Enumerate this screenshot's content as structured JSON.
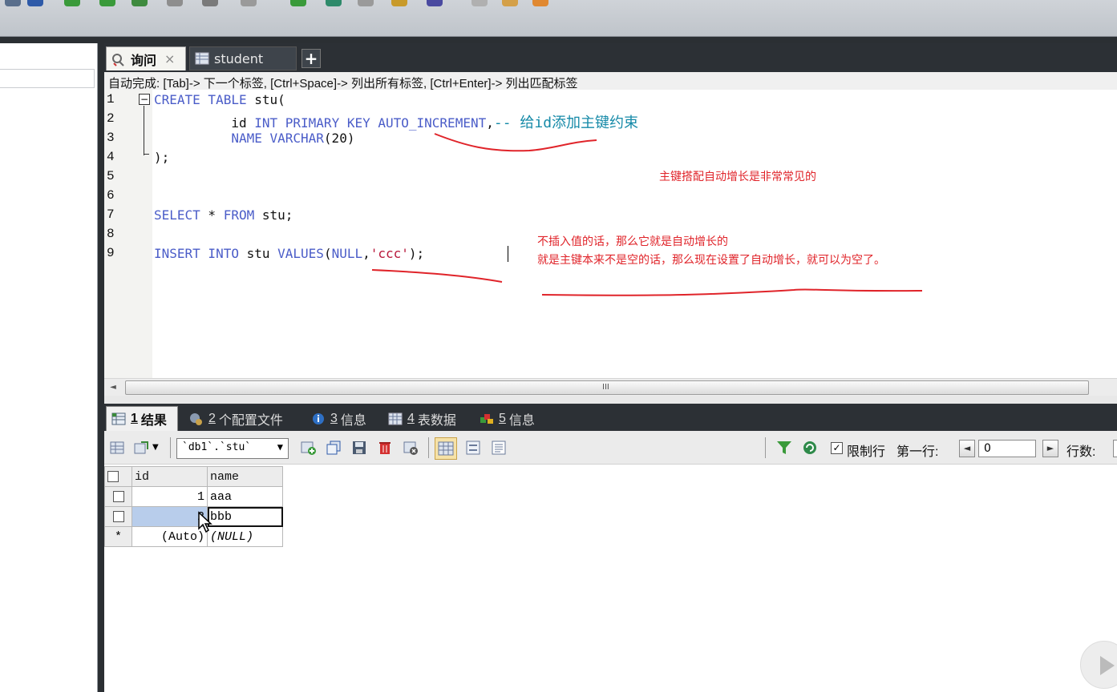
{
  "tabs": {
    "query_label": "询问",
    "student_label": "student",
    "close_glyph": "×",
    "add_glyph": "+"
  },
  "hint": "自动完成: [Tab]-> 下一个标签, [Ctrl+Space]-> 列出所有标签, [Ctrl+Enter]-> 列出匹配标签",
  "editor": {
    "line_numbers": [
      "1",
      "2",
      "3",
      "4",
      "5",
      "6",
      "7",
      "8",
      "9"
    ],
    "fold_glyph": "⊟",
    "line1": {
      "kw": "CREATE TABLE",
      "rest": " stu("
    },
    "line2": {
      "indent": "          ",
      "col": "id ",
      "kw1": "INT PRIMARY KEY AUTO_INCREMENT",
      "sep": ",",
      "comment": "-- 给id添加主键约束"
    },
    "line3": {
      "indent": "          ",
      "kw": "NAME VARCHAR",
      "rest": "(20)"
    },
    "line4": {
      "text": ");"
    },
    "line7": {
      "kw1": "SELECT",
      "mid": " * ",
      "kw2": "FROM",
      "rest": " stu;"
    },
    "line9": {
      "kw1": "INSERT INTO",
      "mid": " stu ",
      "kw2": "VALUES",
      "p1": "(",
      "kw3": "NULL",
      "comma": ",",
      "str": "'ccc'",
      "end": ");"
    }
  },
  "annotations": {
    "note1": "主键搭配自动增长是非常常见的",
    "note2": "不插入值的话，那么它就是自动增长的",
    "note3": "就是主键本来不是空的话，那么现在设置了自动增长，就可以为空了。"
  },
  "scrollbar_grip": "III",
  "result_tabs": [
    {
      "num": "1",
      "label": "结果"
    },
    {
      "num": "2",
      "label": "个配置文件"
    },
    {
      "num": "3",
      "label": "信息"
    },
    {
      "num": "4",
      "label": "表数据"
    },
    {
      "num": "5",
      "label": "信息"
    }
  ],
  "result_toolbar": {
    "db_select": "`db1`.`stu`",
    "limit_checked": "✓",
    "limit_label": "限制行",
    "first_row_label": "第一行:",
    "first_row_value": "0",
    "rows_label": "行数:"
  },
  "grid": {
    "columns": [
      "id",
      "name"
    ],
    "rows": [
      {
        "marker": "",
        "id": "1",
        "name": "aaa"
      },
      {
        "marker": "",
        "id": "2",
        "name": "bbb"
      },
      {
        "marker": "*",
        "id": "(Auto)",
        "name": "(NULL)"
      }
    ]
  },
  "colors": {
    "keyword": "#4a5cc8",
    "string": "#b8173a",
    "comment": "#168aa8",
    "annotation": "#e0242a",
    "dark_chrome": "#2c3035"
  }
}
